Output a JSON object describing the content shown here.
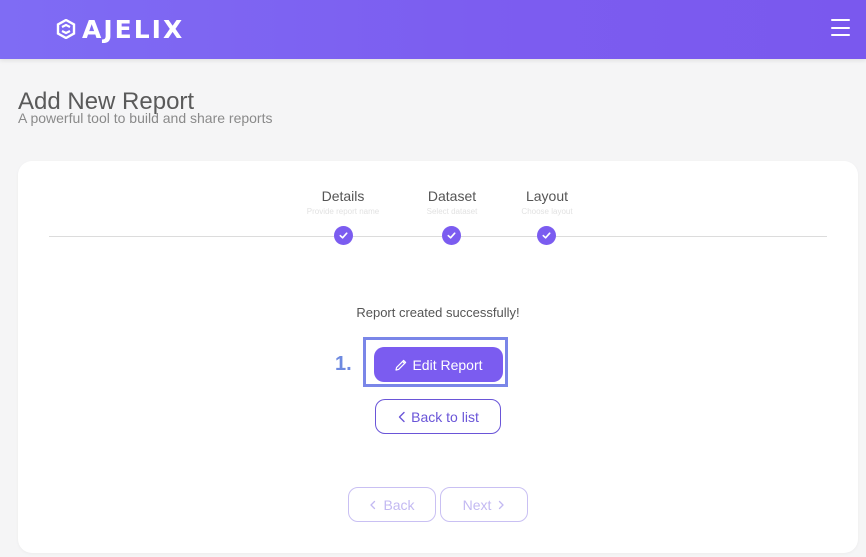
{
  "app": {
    "brand": "AJELIX",
    "colors": {
      "accent": "#7b5cf0",
      "header": "#7c5df0",
      "marker": "#6e8ae0"
    }
  },
  "page": {
    "title": "Add New Report",
    "subtitle": "A powerful tool to build and share reports"
  },
  "steps": [
    {
      "title": "Details",
      "subtitle": "Provide report name",
      "completed": true
    },
    {
      "title": "Dataset",
      "subtitle": "Select dataset",
      "completed": true
    },
    {
      "title": "Layout",
      "subtitle": "Choose layout",
      "completed": true
    }
  ],
  "result": {
    "message": "Report created successfully!",
    "edit_label": "Edit Report",
    "back_label": "Back to list"
  },
  "annotation": {
    "marker": "1."
  },
  "wizard_nav": {
    "back_label": "Back",
    "next_label": "Next"
  },
  "icons": {
    "menu": "hamburger-icon",
    "step_done": "check-icon",
    "edit": "pencil-icon",
    "back": "chevron-left-icon",
    "next": "chevron-right-icon"
  }
}
